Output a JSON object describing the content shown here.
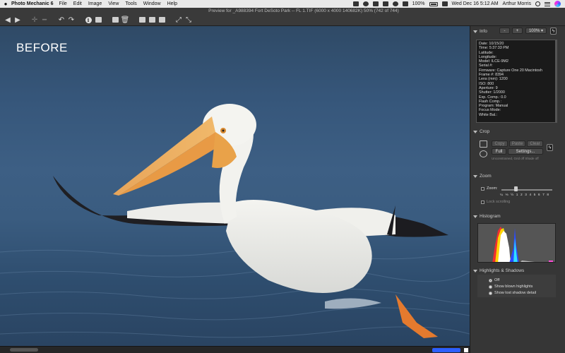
{
  "menubar": {
    "app_name": "Photo Mechanic 6",
    "menus": [
      "File",
      "Edit",
      "Image",
      "View",
      "Tools",
      "Window",
      "Help"
    ],
    "battery": "100%",
    "datetime": "Wed Dec 16  5:12 AM",
    "user": "Arthur Morris"
  },
  "window": {
    "title": "Preview for _A988394 Fort DeSoto Park -- FL 1.TIF (6000 x 4000 140682K) 50% (742 of 744)"
  },
  "photo": {
    "overlay_text": "BEFORE"
  },
  "info": {
    "header": "Info",
    "minus_label": "-",
    "plus_label": "+",
    "zoom_value": "100%",
    "lines": [
      "Date: 10/15/20",
      "Time: 5:37:33 PM",
      "Latitude:",
      "Longitude:",
      "Model: ILCE-9M2",
      "Serial #:",
      "Firmware: Capture One 20 Macintosh",
      "Frame #: 8394",
      "Lens (mm): 1200",
      "ISO: 800",
      "Aperture: 9",
      "Shutter: 1/2000",
      "Exp. Comp.: 0.0",
      "Flash Comp.:",
      "Program: Manual",
      "Focus Mode:",
      "White Bal.:"
    ]
  },
  "crop": {
    "header": "Crop",
    "copy_label": "Copy",
    "paste_label": "Paste",
    "clear_label": "Clear",
    "full_label": "Full",
    "settings_label": "Settings...",
    "status": "Unconstrained, Grid off Shade off"
  },
  "zoom": {
    "header": "Zoom",
    "zoom_label": "Zoom:",
    "ticks": [
      "¼",
      "⅓",
      "½",
      "1",
      "2",
      "3",
      "4",
      "5",
      "6",
      "7",
      "8"
    ],
    "lock_label": "Lock scrolling"
  },
  "histogram": {
    "header": "Histogram"
  },
  "highlights": {
    "header": "Highlights & Shadows",
    "options": [
      "Off",
      "Show blown highlights",
      "Show lost shadow detail"
    ],
    "selected": "Off"
  },
  "colors": {
    "accent_blue": "#2d5fff",
    "panel_bg": "#363636"
  }
}
